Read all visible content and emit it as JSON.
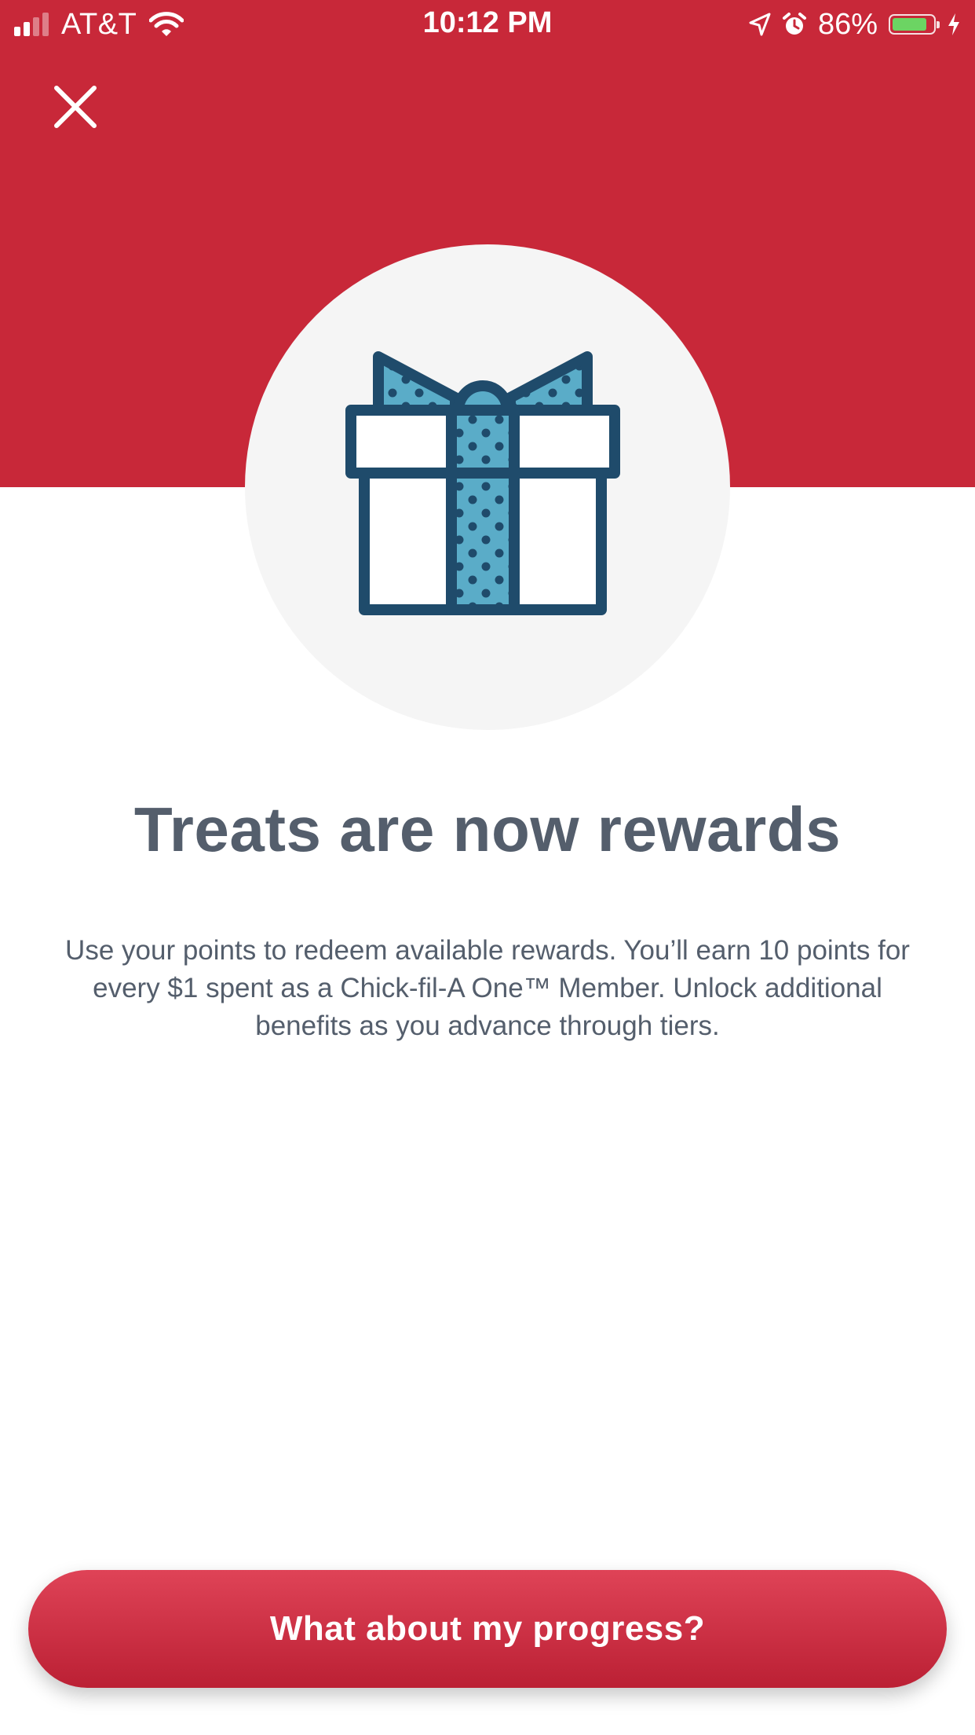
{
  "status_bar": {
    "carrier": "AT&T",
    "time": "10:12 PM",
    "battery_percent": "86%",
    "battery_level": 0.86,
    "icons": [
      "signal-icon",
      "wifi-icon",
      "location-arrow-icon",
      "alarm-icon",
      "battery-icon",
      "charging-bolt-icon"
    ]
  },
  "close": {
    "icon": "close-icon"
  },
  "hero": {
    "icon": "gift-icon",
    "background_color": "#c82839",
    "circle_color": "#f5f5f5"
  },
  "content": {
    "title": "Treats are now rewards",
    "description": "Use your points to redeem available rewards. You’ll earn 10 points for every $1 spent as a Chick-fil-A One™ Member. Unlock additional benefits as you advance through tiers."
  },
  "cta": {
    "label": "What about my progress?",
    "color": "#c82839"
  }
}
